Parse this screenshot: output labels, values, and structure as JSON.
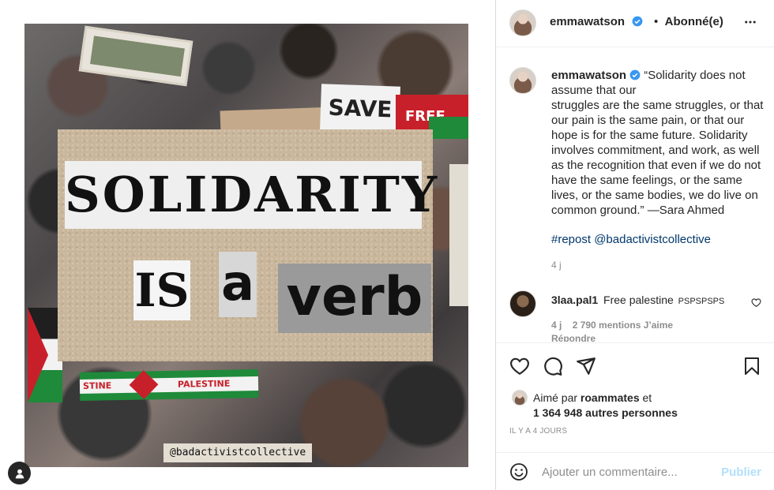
{
  "post": {
    "author": "emmawatson",
    "follow_status": "Abonné(e)",
    "separator": "•",
    "image_texts": {
      "main_word": "SOLIDARITY",
      "word_is": "IS",
      "word_a": "a",
      "word_verb": "verb",
      "sign_save": "SAVE",
      "sign_free": "FREE",
      "banner_left": "STINE",
      "banner_right": "PALESTINE",
      "credit": "@badactivistcollective"
    }
  },
  "caption": {
    "username": "emmawatson",
    "text": "“Solidarity does not assume that our\nstruggles are the same struggles, or that our pain is the same pain, or that our hope is for the same future. Solidarity involves commitment, and work, as well as the recognition that even if we do not have the same feelings, or the same lives, or the same bodies, we do live on common ground.” —Sara Ahmed",
    "hashtags": "#repost @badactivistcollective",
    "time": "4 j"
  },
  "comment": {
    "username": "3laa.pal1",
    "text": "Free palestine",
    "suffix": "PSPSPSPS",
    "time": "4 j",
    "likes": "2 790 mentions J’aime",
    "reply": "Répondre"
  },
  "likes": {
    "prefix": "Aimé par",
    "user": "roammates",
    "connector": "et",
    "others": "1 364 948 autres personnes"
  },
  "post_age": "IL Y A 4 JOURS",
  "add_comment": {
    "placeholder": "Ajouter un commentaire...",
    "publish": "Publier"
  },
  "icons": {
    "verified_color": "#3897f0",
    "publish_color": "#b2dffc"
  }
}
